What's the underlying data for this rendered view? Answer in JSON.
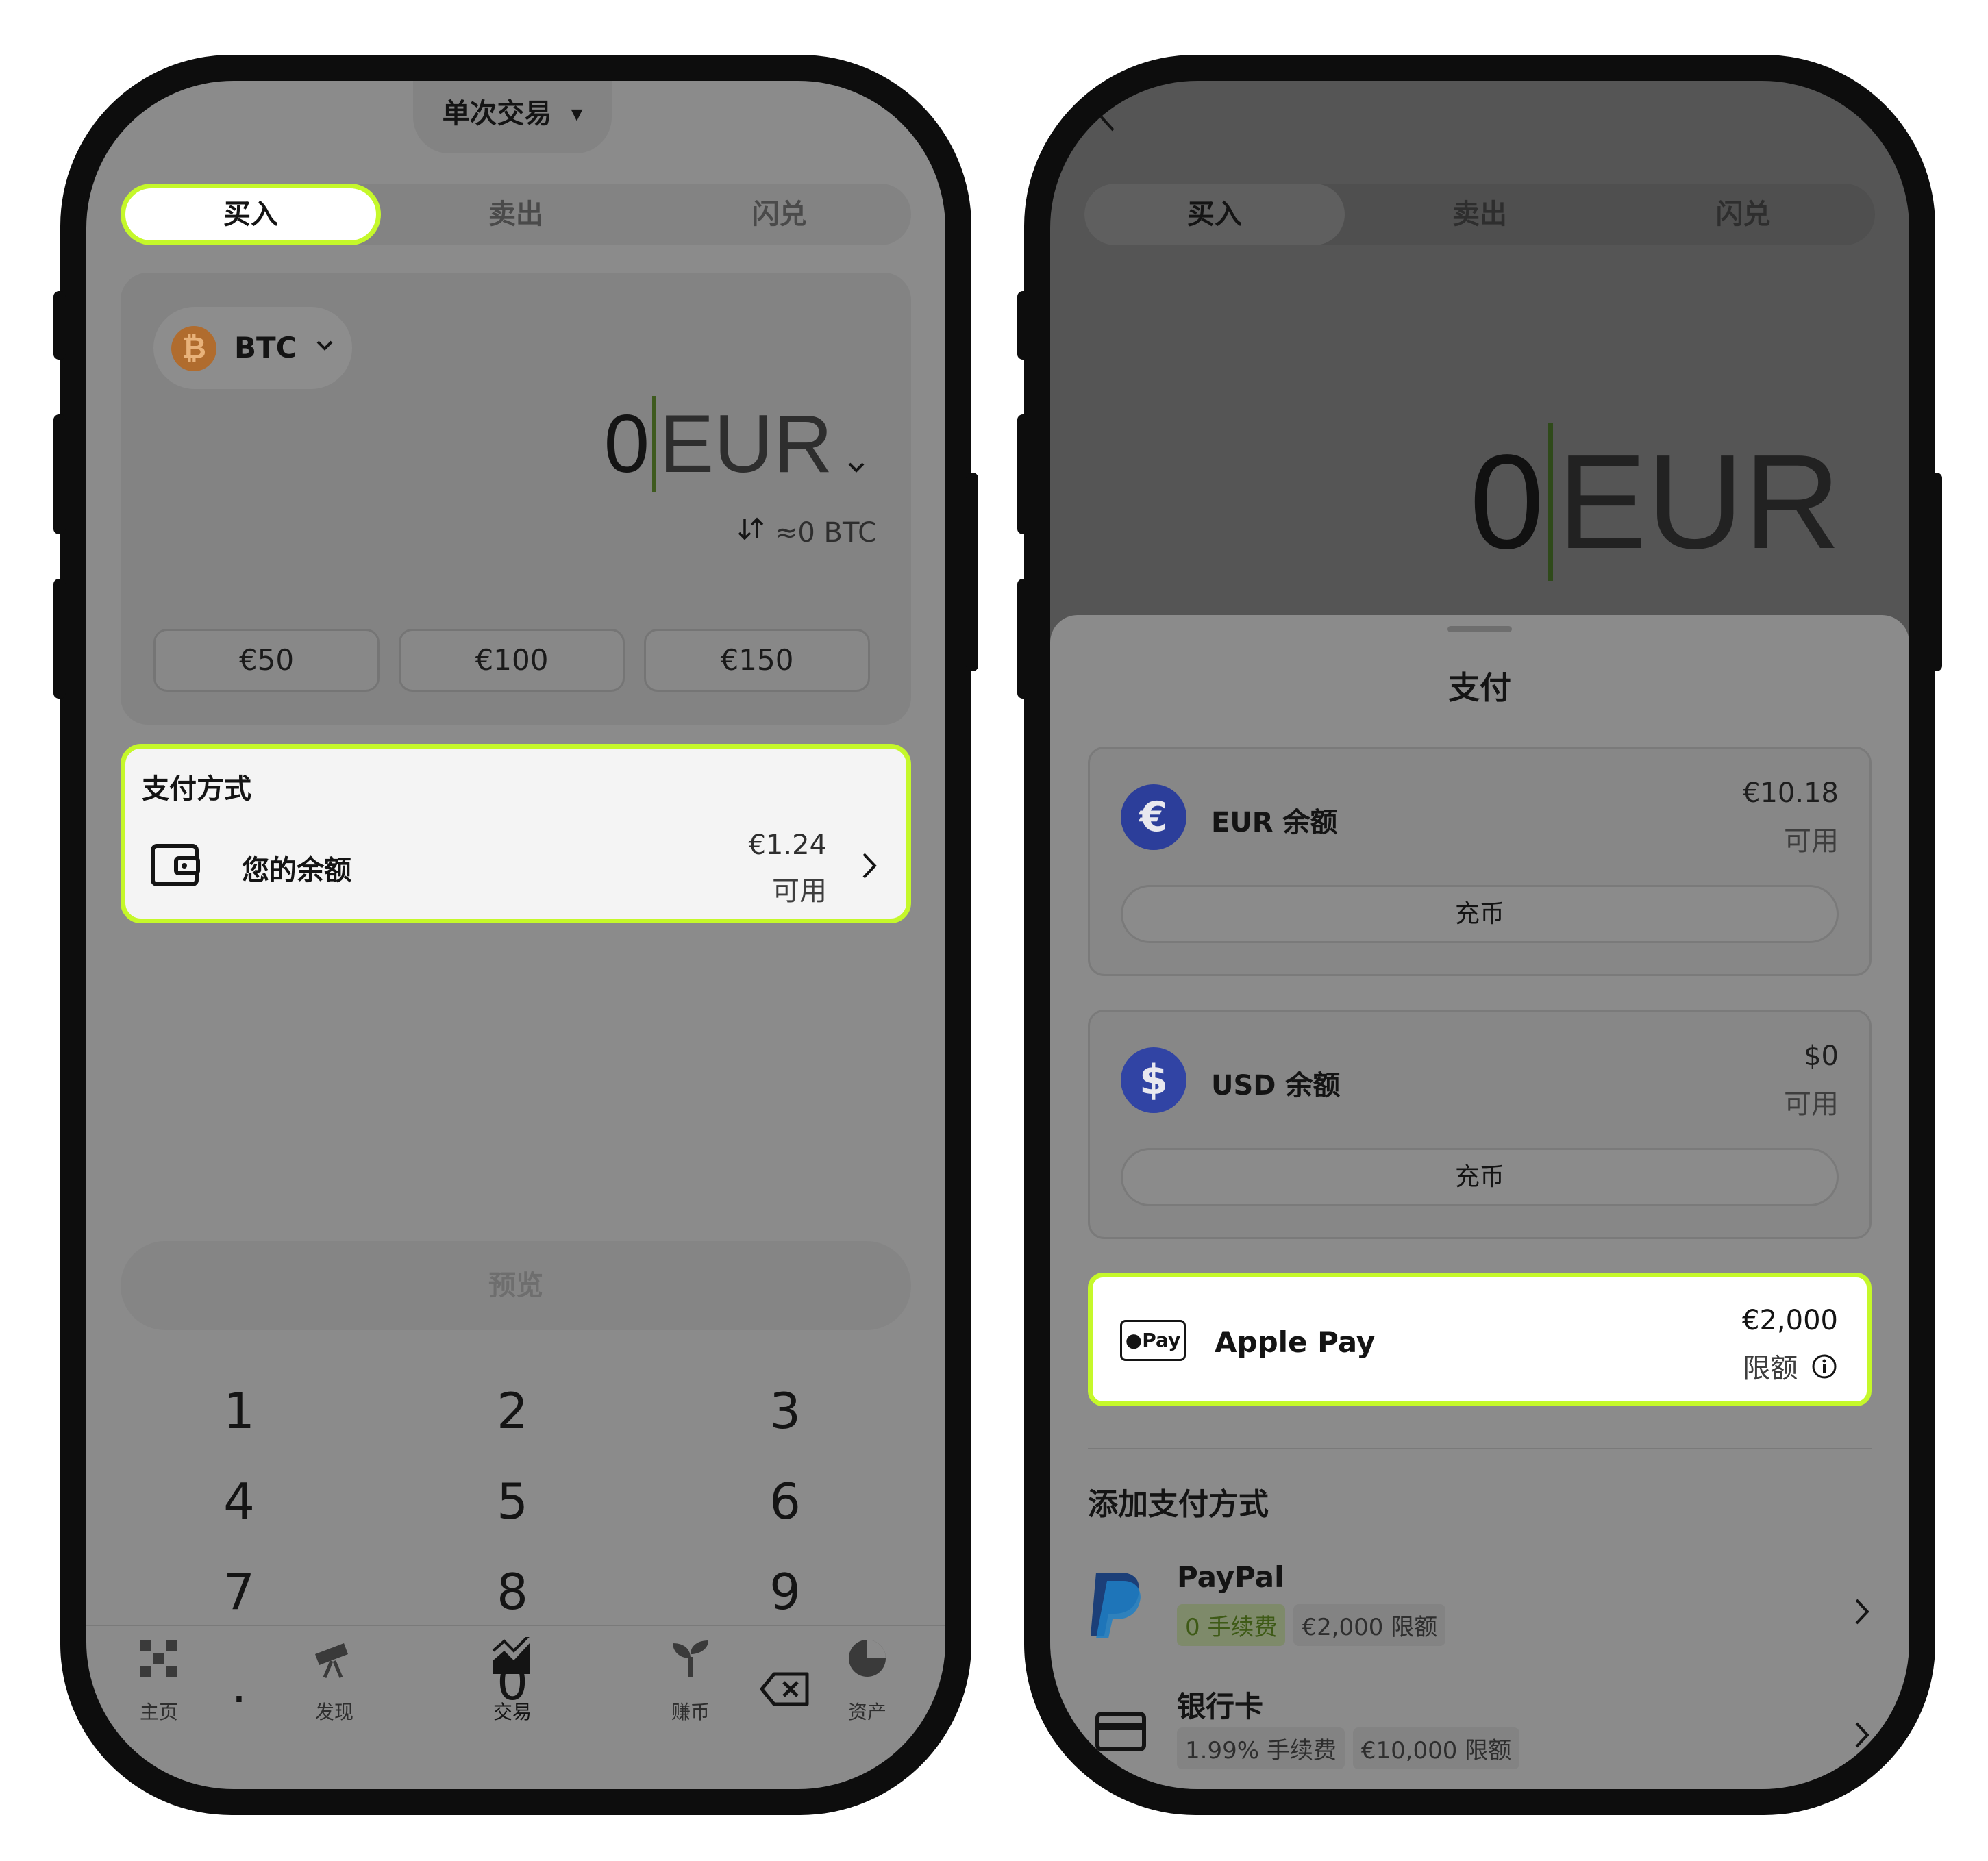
{
  "left": {
    "mode_selector": "单次交易",
    "tabs": [
      "买入",
      "卖出",
      "闪兑"
    ],
    "asset": "BTC",
    "amount": "0",
    "currency": "EUR",
    "conversion": "≈0 BTC",
    "quick_amounts": [
      "€50",
      "€100",
      "€150"
    ],
    "payment": {
      "title": "支付方式",
      "method": "您的余额",
      "amount": "€1.24",
      "status": "可用"
    },
    "preview_label": "预览",
    "keypad": [
      "1",
      "2",
      "3",
      "4",
      "5",
      "6",
      "7",
      "8",
      "9",
      ".",
      "0"
    ],
    "nav": [
      "主页",
      "发现",
      "交易",
      "赚币",
      "资产"
    ]
  },
  "right": {
    "tabs": [
      "买入",
      "卖出",
      "闪兑"
    ],
    "amount": "0",
    "currency": "EUR",
    "sheet_title": "支付",
    "eur": {
      "name": "EUR 余额",
      "amount": "€10.18",
      "status": "可用",
      "action": "充币"
    },
    "usd": {
      "name": "USD 余额",
      "amount": "$0",
      "status": "可用",
      "action": "充币"
    },
    "applepay": {
      "badge": "Pay",
      "name": "Apple Pay",
      "amount": "€2,000",
      "status": "限额"
    },
    "add_title": "添加支付方式",
    "paypal": {
      "name": "PayPal",
      "tag1": "0 手续费",
      "tag2": "€2,000 限额"
    },
    "bankcard": {
      "name": "银行卡",
      "tag1": "1.99% 手续费",
      "tag2": "€10,000 限额"
    }
  },
  "colors": {
    "highlight": "#c5f82a",
    "btc": "#f7931a",
    "coin_blue": "#2c3e9a"
  }
}
